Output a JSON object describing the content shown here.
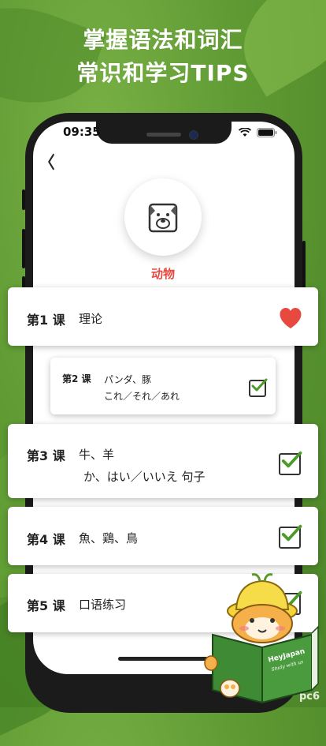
{
  "promo": {
    "line1": "掌握语法和词汇",
    "line2": "常识和学习TIPS"
  },
  "status_bar": {
    "time": "09:35"
  },
  "nav": {
    "back_icon": "chevron-left-icon"
  },
  "category": {
    "icon": "dog-icon",
    "label": "动物",
    "label_color": "#e8493f"
  },
  "lessons": [
    {
      "num": "第1 课",
      "line1": "理论",
      "line2": "",
      "status": "favorite"
    },
    {
      "num": "第2 课",
      "line1": "パンダ、豚",
      "line2": "これ／それ／あれ",
      "status": "checked"
    },
    {
      "num": "第3 课",
      "line1": "牛、羊",
      "line2": "か、はい／いいえ 句子",
      "status": "checked"
    },
    {
      "num": "第4 课",
      "line1": "魚、鶏、鳥",
      "line2": "",
      "status": "checked"
    },
    {
      "num": "第5 课",
      "line1": "口语练习",
      "line2": "",
      "status": "checked"
    }
  ],
  "mascot": {
    "book_title": "HeyJapan",
    "book_subtitle": "Study with us"
  },
  "watermark": "pc6"
}
